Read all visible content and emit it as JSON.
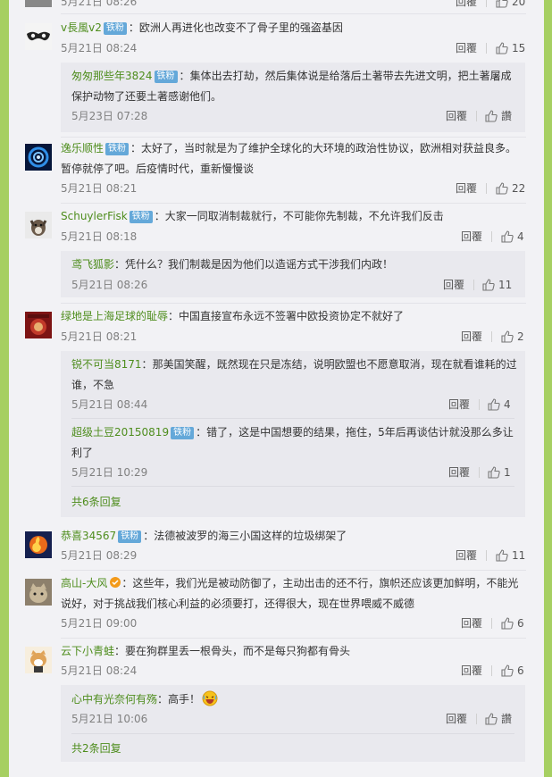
{
  "comments": [
    {
      "user": "v長風v2",
      "badge": "铁粉",
      "text": "欧洲人再进化也改变不了骨子里的强盗基因",
      "time": "5月21日 08:24",
      "reply": "回覆",
      "likes": "15",
      "subs": [
        {
          "user": "匆匆那些年3824",
          "badge": "铁粉",
          "text1": "集体出去打劫，然后集体说是给落后土著带去先进文明，把土著屠成",
          "text2": "保护动物了还要土著感谢他们。",
          "time": "5月23日 07:28",
          "reply": "回覆",
          "likes": "讚"
        }
      ]
    },
    {
      "user": "逸乐顺性",
      "badge": "铁粉",
      "text1": "太好了，当时就是为了维护全球化的大环境的政治性协议，欧洲相对获益良多。",
      "text2": "暂停就停了吧。后疫情时代，重新慢慢谈",
      "time": "5月21日 08:21",
      "reply": "回覆",
      "likes": "22"
    },
    {
      "user": "SchuylerFisk",
      "badge": "铁粉",
      "text": "大家一同取消制裁就行，不可能你先制裁，不允许我们反击",
      "time": "5月21日 08:18",
      "reply": "回覆",
      "likes": "4",
      "subs": [
        {
          "user": "鸢飞狐影",
          "text": "凭什么？我们制裁是因为他们以造谣方式干涉我们内政！",
          "time": "5月21日 08:26",
          "reply": "回覆",
          "likes": "11"
        }
      ]
    },
    {
      "user": "绿地是上海足球的耻辱",
      "text": "中国直接宣布永远不签署中欧投资协定不就好了",
      "time": "5月21日 08:21",
      "reply": "回覆",
      "likes": "2",
      "subs": [
        {
          "user": "锐不可当8171",
          "text1": "那美国笑醒，既然现在只是冻结，说明欧盟也不愿意取消，现在就看谁耗的过",
          "text2": "谁，不急",
          "time": "5月21日 08:44",
          "reply": "回覆",
          "likes": "4"
        },
        {
          "user": "超级土豆20150819",
          "badge": "铁粉",
          "text1": "错了，这是中国想要的结果，拖住，5年后再谈估计就没那么多让",
          "text2": "利了",
          "time": "5月21日 10:29",
          "reply": "回覆",
          "likes": "1"
        }
      ],
      "more": "共6条回复"
    },
    {
      "user": "恭喜34567",
      "badge": "铁粉",
      "text": "法德被波罗的海三小国这样的垃圾绑架了",
      "time": "5月21日 08:29",
      "reply": "回覆",
      "likes": "11"
    },
    {
      "user": "高山-大风",
      "text1": "这些年，我们光是被动防御了，主动出击的还不行，旗帜还应该更加鲜明，不能光",
      "text2": "说好，对于挑战我们核心利益的必须要打，还得很大，现在世界喂威不威德",
      "time": "5月21日 09:00",
      "reply": "回覆",
      "likes": "6"
    },
    {
      "user": "云下小青蛙",
      "text": "要在狗群里丢一根骨头，而不是每只狗都有骨头",
      "time": "5月21日 08:24",
      "reply": "回覆",
      "likes": "6",
      "subs": [
        {
          "user": "心中有光奈何有殇",
          "text": "高手！",
          "time": "5月21日 10:06",
          "reply": "回覆",
          "likes": "讚"
        }
      ],
      "more": "共2条回复"
    }
  ],
  "top_partial": {
    "time": "5月21日 08:26",
    "reply": "回覆",
    "likes": "20"
  }
}
